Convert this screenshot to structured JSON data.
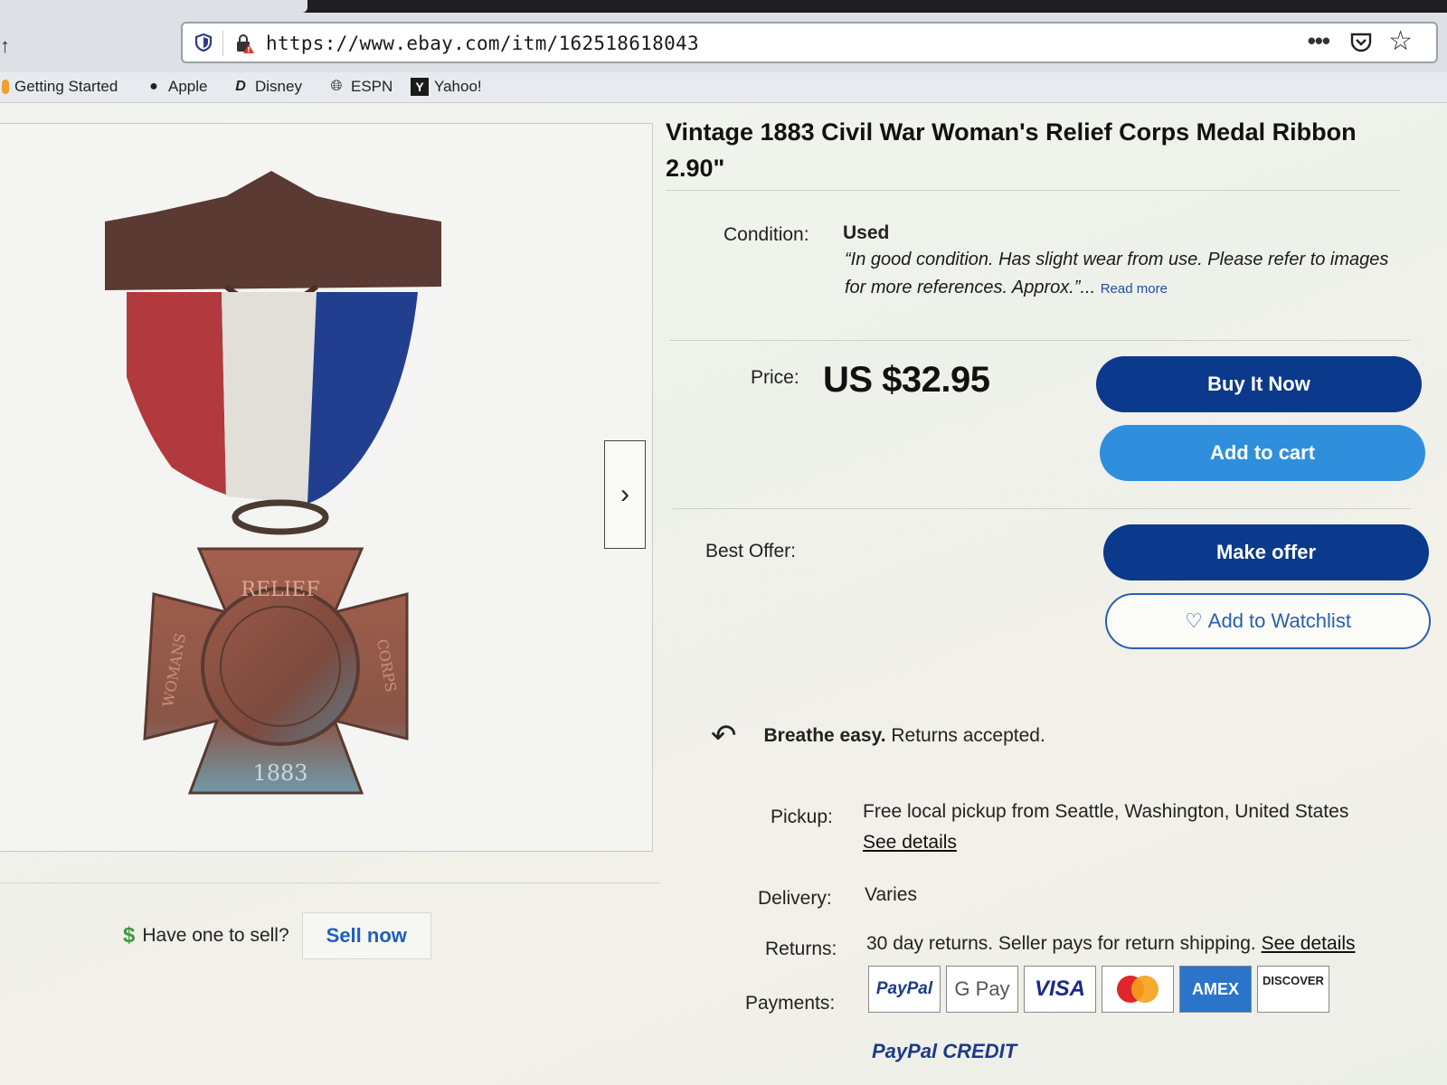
{
  "browser": {
    "url": "https://www.ebay.com/itm/162518618043",
    "bookmarks": [
      {
        "label": "Getting Started",
        "icon": "firefox-icon"
      },
      {
        "label": "Apple",
        "icon": "apple-icon"
      },
      {
        "label": "Disney",
        "icon": "disney-icon"
      },
      {
        "label": "ESPN",
        "icon": "globe-icon"
      },
      {
        "label": "Yahoo!",
        "icon": "yahoo-icon"
      }
    ]
  },
  "listing": {
    "title": "Vintage 1883 Civil War Woman's Relief Corps Medal Ribbon 2.90\"",
    "condition_label": "Condition:",
    "condition_value": "Used",
    "condition_desc": "“In good condition. Has slight wear from use. Please refer to images for more references. Approx.”...",
    "read_more": "Read more",
    "price_label": "Price:",
    "price": "US $32.95",
    "buy_now": "Buy It Now",
    "add_to_cart": "Add to cart",
    "best_offer_label": "Best Offer:",
    "make_offer": "Make offer",
    "add_to_watchlist": "Add to Watchlist",
    "returns_banner_bold": "Breathe easy.",
    "returns_banner_text": " Returns accepted.",
    "pickup_label": "Pickup:",
    "pickup_value": "Free local pickup from Seattle, Washington, United States",
    "pickup_link": "See details",
    "delivery_label": "Delivery:",
    "delivery_value": "Varies",
    "returns_label": "Returns:",
    "returns_value": "30 day returns. Seller pays for return shipping.",
    "returns_link": "See details",
    "payments_label": "Payments:",
    "payment_methods": [
      "PayPal",
      "G Pay",
      "VISA",
      "Mastercard",
      "AMEX",
      "DISCOVER"
    ],
    "paypal_credit": "PayPal CREDIT"
  },
  "sell": {
    "question": "Have one to sell?",
    "button": "Sell now"
  },
  "medal": {
    "top_text": "RELIEF",
    "left_text": "WOMANS",
    "right_text": "CORPS",
    "year": "1883"
  },
  "colors": {
    "primary_button": "#0b3a8c",
    "secondary_button": "#2f8fdc",
    "link": "#1f5fbf"
  }
}
